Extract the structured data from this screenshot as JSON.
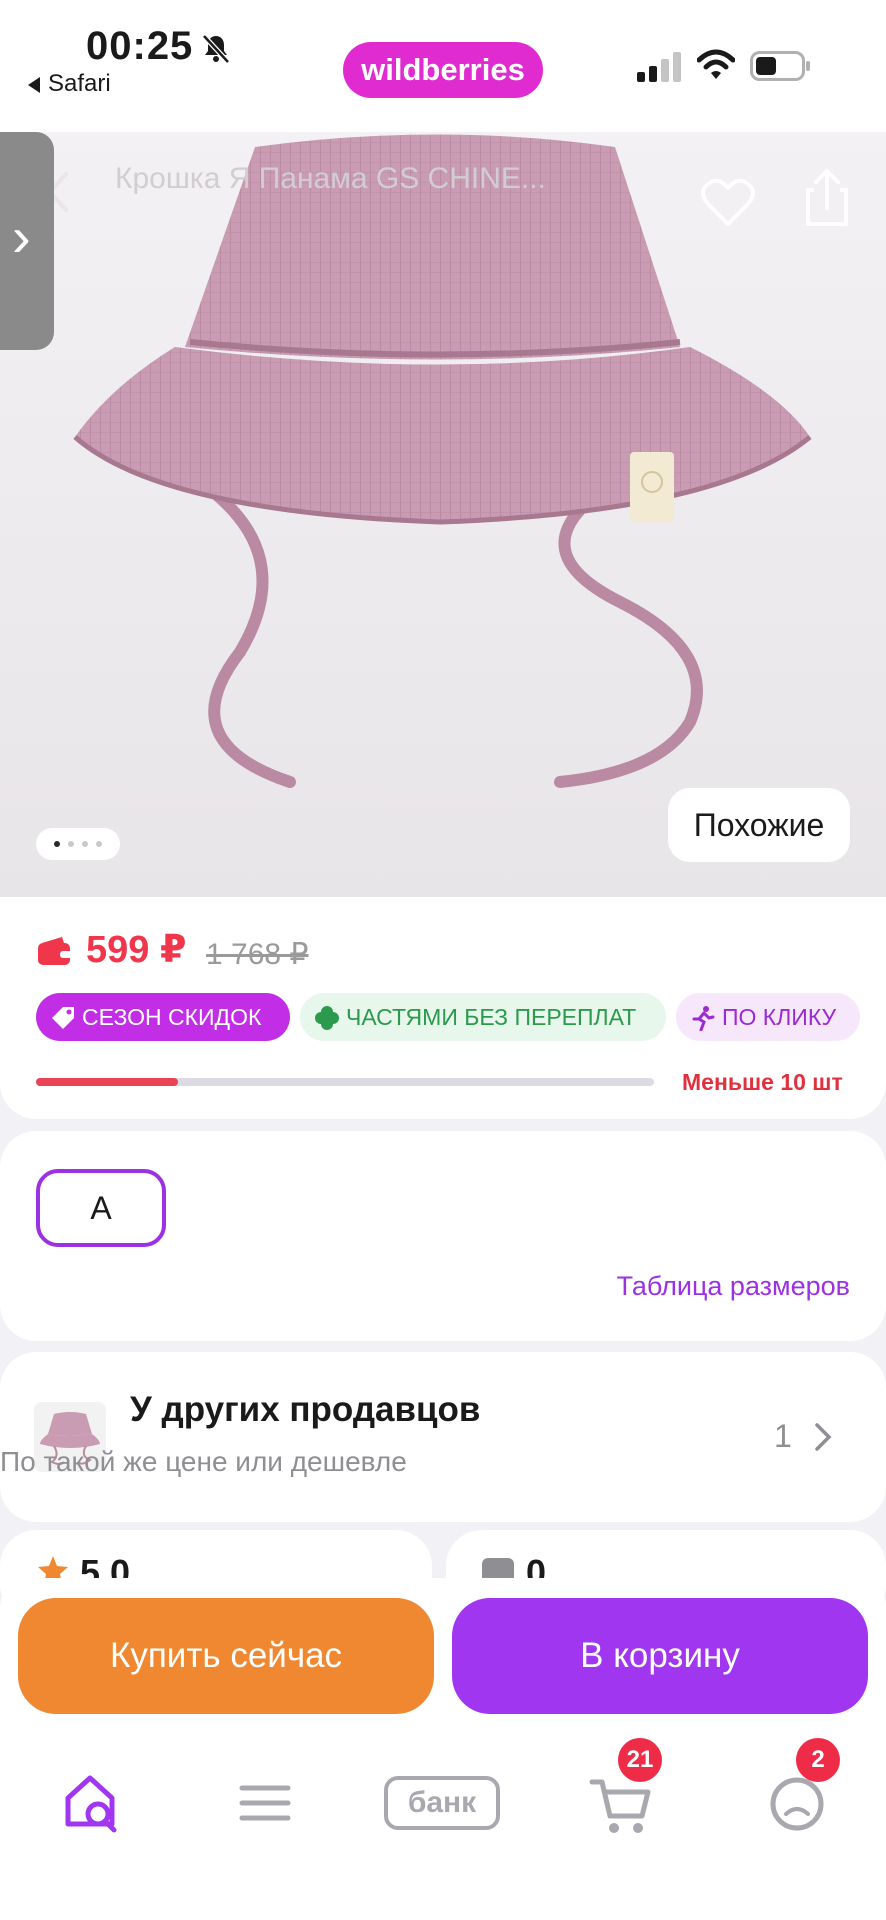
{
  "status_bar": {
    "time": "00:25",
    "back_app": "Safari"
  },
  "header": {
    "logo": "wildberries",
    "title": "Крошка Я Панама GS CHINE..."
  },
  "hero": {
    "similar_label": "Похожие",
    "image_index": 1,
    "image_count": 4
  },
  "price": {
    "current": "599 ₽",
    "old": "1 768 ₽",
    "badges": [
      "СЕЗОН СКИДОК",
      "ЧАСТЯМИ БЕЗ ПЕРЕПЛАТ",
      "ПО КЛИКУ"
    ],
    "stock_label": "Меньше 10 шт",
    "stock_fraction": 0.23
  },
  "sizes": {
    "options": [
      "A"
    ],
    "table_link": "Таблица размеров"
  },
  "other_sellers": {
    "title": "У других продавцов",
    "subtitle": "По такой же цене или дешевле",
    "count": "1"
  },
  "rating": {
    "value": "5.0",
    "questions": "0"
  },
  "actions": {
    "buy_now": "Купить сейчас",
    "add_to_cart": "В корзину"
  },
  "nav": {
    "bank_label": "банк",
    "cart_badge": "21",
    "profile_badge": "2"
  },
  "colors": {
    "brand": "#e02bd0",
    "accent_purple": "#a136f0",
    "buy_orange": "#ef8830",
    "price_red": "#f0364b"
  }
}
